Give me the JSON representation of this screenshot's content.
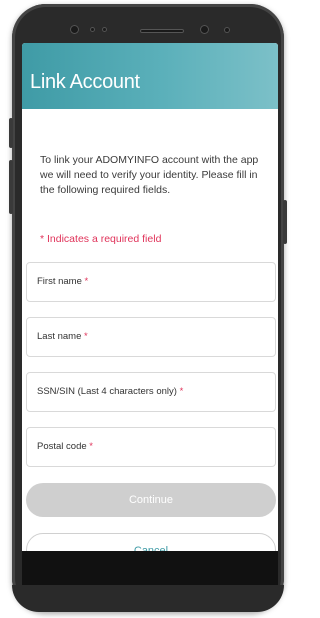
{
  "header": {
    "title": "Link Account"
  },
  "intro": {
    "text": "To link your ADOMYINFO account with the app we will need to verify your identity. Please fill in the following required fields."
  },
  "required_note": "* Indicates a required field",
  "form": {
    "fields": [
      {
        "label": "First name",
        "required_mark": "*"
      },
      {
        "label": "Last name",
        "required_mark": "*"
      },
      {
        "label": "SSN/SIN (Last 4 characters only)",
        "required_mark": "*"
      },
      {
        "label": "Postal code",
        "required_mark": "*"
      }
    ]
  },
  "actions": {
    "continue_label": "Continue",
    "cancel_label": "Cancel"
  },
  "colors": {
    "header_teal": "#3f9ba6",
    "required_red": "#e0335a",
    "disabled_button": "#cfcfcf"
  }
}
